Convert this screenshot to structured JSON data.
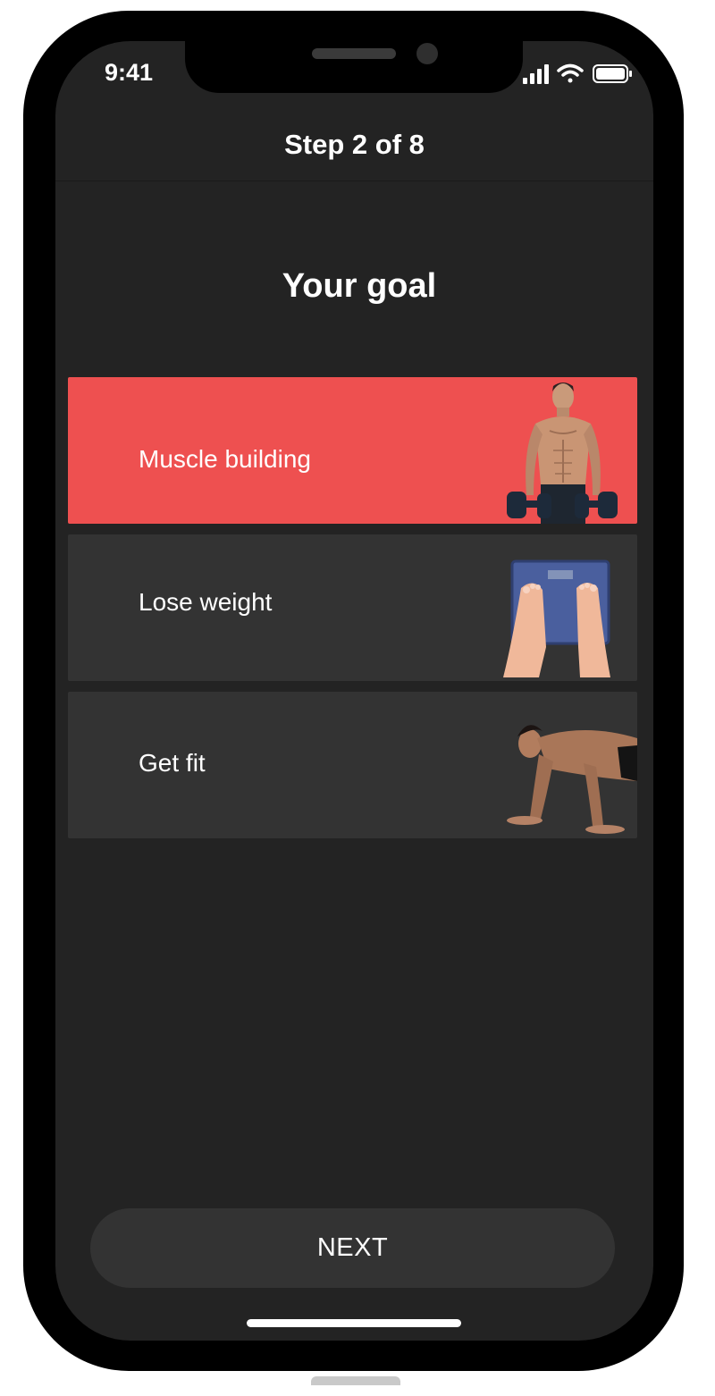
{
  "status_bar": {
    "time": "9:41"
  },
  "header": {
    "title": "Step 2 of 8"
  },
  "page": {
    "title": "Your goal"
  },
  "options": [
    {
      "label": "Muscle building",
      "selected": true
    },
    {
      "label": "Lose weight",
      "selected": false
    },
    {
      "label": "Get fit",
      "selected": false
    }
  ],
  "footer": {
    "next_label": "NEXT"
  },
  "colors": {
    "background": "#232323",
    "card": "#333333",
    "selected_card": "#ee5050",
    "text": "#ffffff"
  }
}
